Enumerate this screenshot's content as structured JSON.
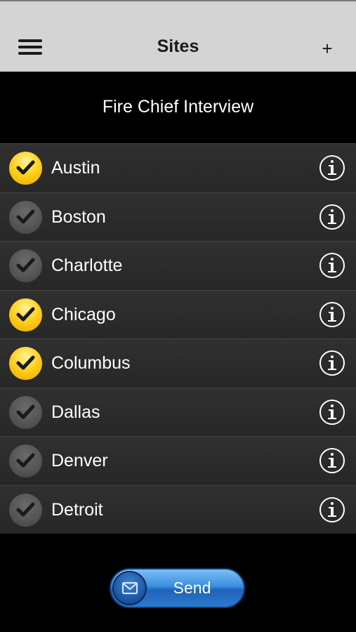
{
  "navbar": {
    "title": "Sites",
    "menu_icon": "hamburger-menu-icon",
    "add_label": "+"
  },
  "subtitle": "Fire Chief Interview",
  "sites": [
    {
      "name": "Austin",
      "checked": true
    },
    {
      "name": "Boston",
      "checked": false
    },
    {
      "name": "Charlotte",
      "checked": false
    },
    {
      "name": "Chicago",
      "checked": true
    },
    {
      "name": "Columbus",
      "checked": true
    },
    {
      "name": "Dallas",
      "checked": false
    },
    {
      "name": "Denver",
      "checked": false
    },
    {
      "name": "Detroit",
      "checked": false
    }
  ],
  "send": {
    "label": "Send",
    "icon": "envelope-icon"
  },
  "colors": {
    "navbar_bg": "#d4d4d4",
    "checked": "#ffd21c",
    "unchecked": "#545454",
    "send_blue": "#3a8ee0"
  }
}
